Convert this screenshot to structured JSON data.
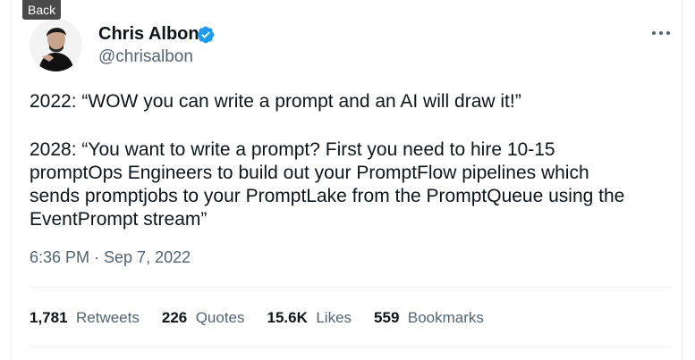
{
  "nav": {
    "back_label": "Back"
  },
  "author": {
    "name": "Chris Albon",
    "handle": "@chrisalbon",
    "verified": true
  },
  "tweet": {
    "lines_block1": [
      "2022: “WOW you can write a prompt and an AI will draw it!”"
    ],
    "lines_block2": [
      "2028: “You want to write a prompt? First you need to hire 10-15",
      "promptOps Engineers to build out your PromptFlow pipelines which",
      "sends promptjobs to your PromptLake from the PromptQueue using the",
      "EventPrompt stream”"
    ],
    "timestamp": "6:36 PM · Sep 7, 2022"
  },
  "stats": [
    {
      "count": "1,781",
      "label": "Retweets"
    },
    {
      "count": "226",
      "label": "Quotes"
    },
    {
      "count": "15.6K",
      "label": "Likes"
    },
    {
      "count": "559",
      "label": "Bookmarks"
    }
  ],
  "colors": {
    "text": "#0f1419",
    "secondary": "#536471",
    "verified": "#1d9bf0",
    "divider": "#eff3f4"
  },
  "icons": {
    "verified": "verified-badge-icon",
    "more": "more-icon"
  }
}
